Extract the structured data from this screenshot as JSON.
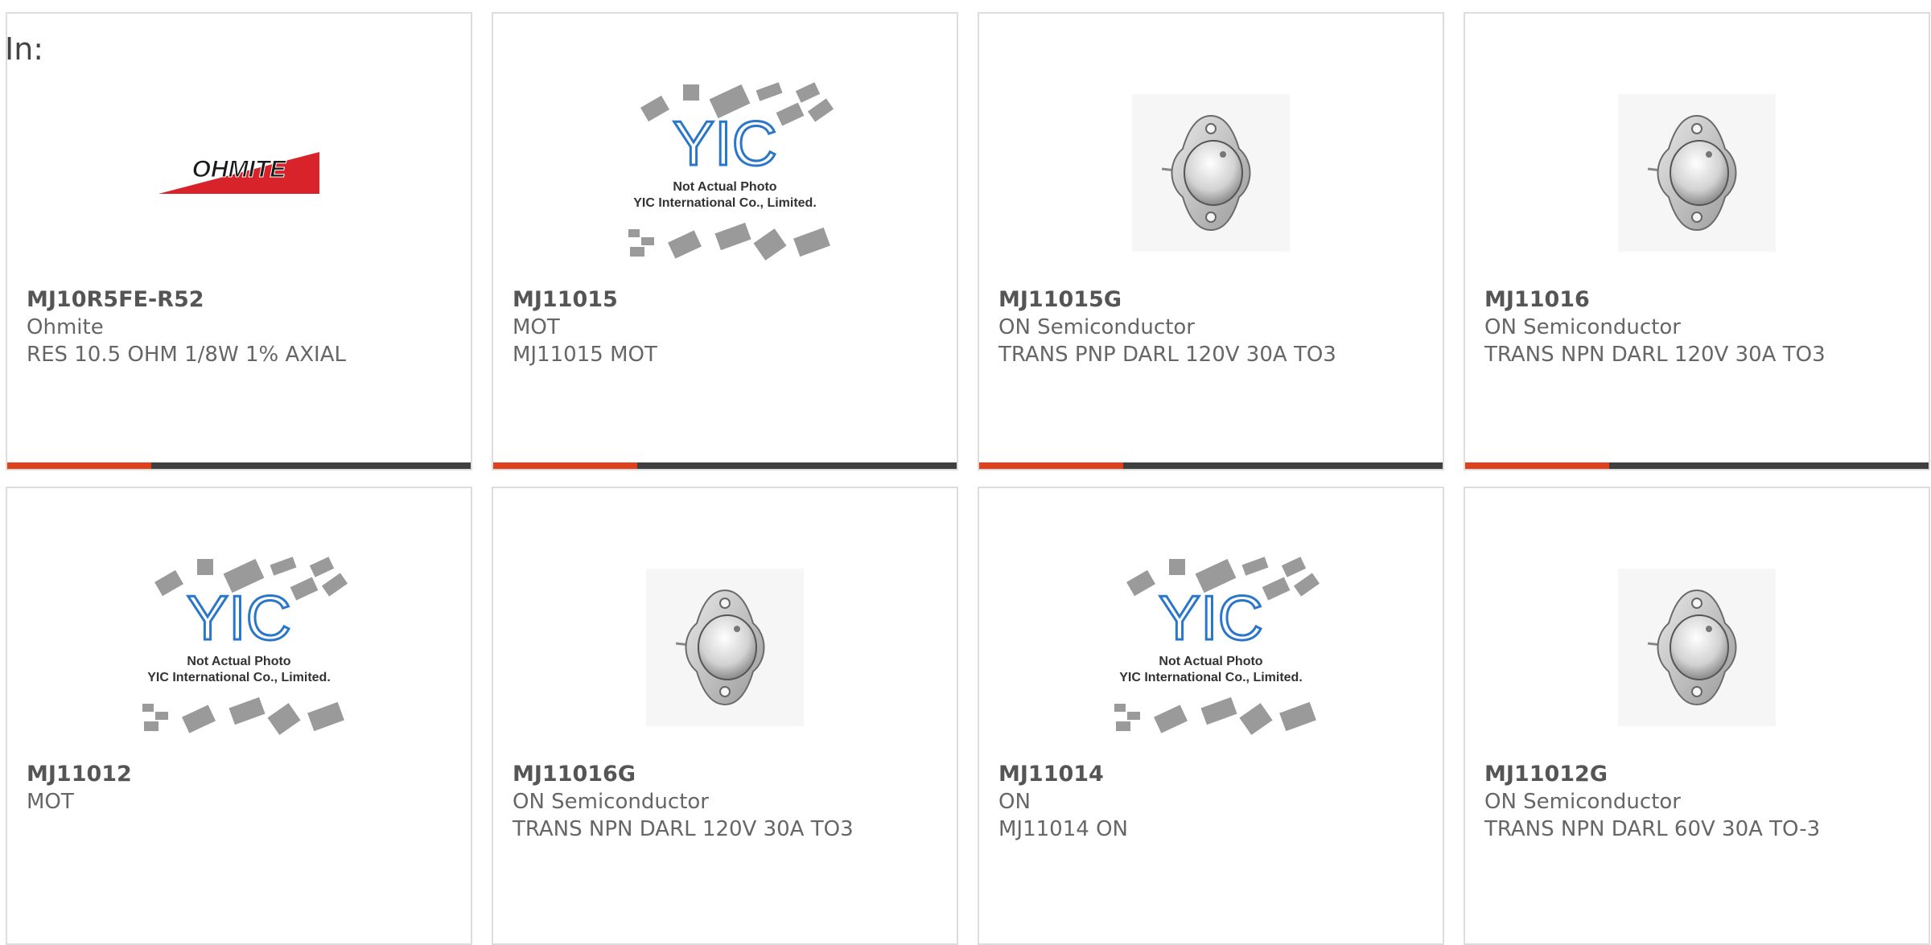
{
  "page_label": "In:",
  "colors": {
    "accent_bar": "#e0401c",
    "dark_bar": "#3f3f3f",
    "card_border": "#dddddd",
    "ohmite_red": "#d8232a",
    "yic_blue": "#2a77c9"
  },
  "logos": {
    "ohmite_text": "OHMITE",
    "yic_letters": "YIC",
    "yic_caption_line1": "Not Actual Photo",
    "yic_caption_line2": "YIC International Co., Limited."
  },
  "products": [
    {
      "part_number": "MJ10R5FE-R52",
      "manufacturer": "Ohmite",
      "description": "RES 10.5 OHM 1/8W 1% AXIAL",
      "image": "ohmite-logo",
      "progress_fraction": 0.31
    },
    {
      "part_number": "MJ11015",
      "manufacturer": "MOT",
      "description": "MJ11015 MOT",
      "image": "yic-placeholder",
      "progress_fraction": 0.31
    },
    {
      "part_number": "MJ11015G",
      "manufacturer": "ON Semiconductor",
      "description": "TRANS PNP DARL 120V 30A TO3",
      "image": "to3-transistor",
      "progress_fraction": 0.31
    },
    {
      "part_number": "MJ11016",
      "manufacturer": "ON Semiconductor",
      "description": "TRANS NPN DARL 120V 30A TO3",
      "image": "to3-transistor",
      "progress_fraction": 0.31
    },
    {
      "part_number": "MJ11012",
      "manufacturer": "MOT",
      "description": "",
      "image": "yic-placeholder"
    },
    {
      "part_number": "MJ11016G",
      "manufacturer": "ON Semiconductor",
      "description": "TRANS NPN DARL 120V 30A TO3",
      "image": "to3-transistor"
    },
    {
      "part_number": "MJ11014",
      "manufacturer": "ON",
      "description": "MJ11014 ON",
      "image": "yic-placeholder"
    },
    {
      "part_number": "MJ11012G",
      "manufacturer": "ON Semiconductor",
      "description": "TRANS NPN DARL 60V 30A TO-3",
      "image": "to3-transistor"
    }
  ]
}
